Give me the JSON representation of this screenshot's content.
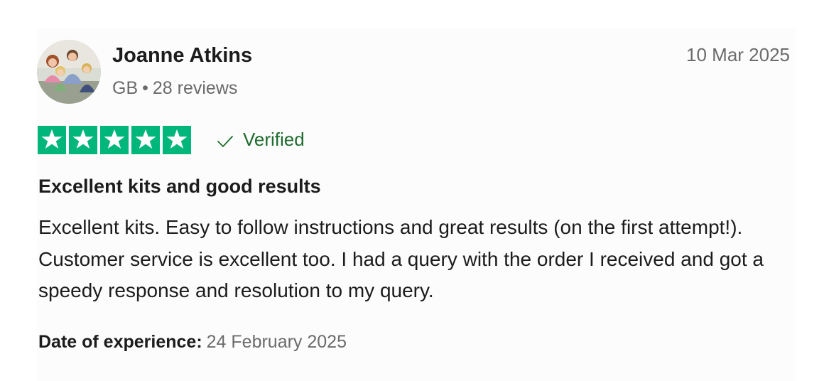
{
  "reviewer": {
    "name": "Joanne Atkins",
    "country": "GB",
    "separator": "•",
    "review_count": "28 reviews",
    "avatar_icon": "family-photo-avatar"
  },
  "review": {
    "date": "10 Mar 2025",
    "rating": 5,
    "rating_max": 5,
    "star_color": "#00b67a",
    "verified_label": "Verified",
    "verified_color": "#1e6b2e",
    "title": "Excellent kits and good results",
    "body": "Excellent kits. Easy to follow instructions and great results (on the first attempt!). Customer service is excellent too. I had a query with the order I received and got a speedy response and resolution to my query.",
    "experience_label": "Date of experience:",
    "experience_date": "24 February 2025"
  }
}
